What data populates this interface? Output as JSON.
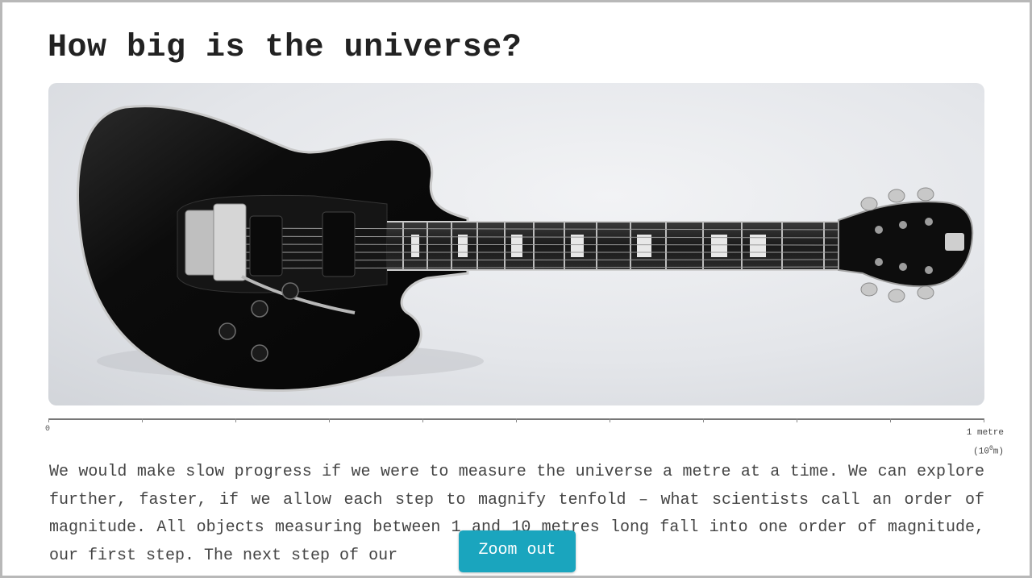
{
  "page": {
    "title": "How big is the universe?",
    "intro_text": "We would make slow progress if we were to measure the universe a metre at a time. We can explore further, faster, if we allow each step to magnify tenfold – what scientists call an order of magnitude. All objects measuring between 1 and 10 metres long fall into one order of magnitude, our first step. The next step of our"
  },
  "image": {
    "subject": "guitar",
    "background_color": "#e3e5e9"
  },
  "scale": {
    "start_label": "0",
    "end_label": "1 metre",
    "exponent_base": "(10",
    "exponent": "0",
    "exponent_unit": "m)"
  },
  "controls": {
    "zoom_out_label": "Zoom out",
    "accent": "#1aa5be"
  }
}
